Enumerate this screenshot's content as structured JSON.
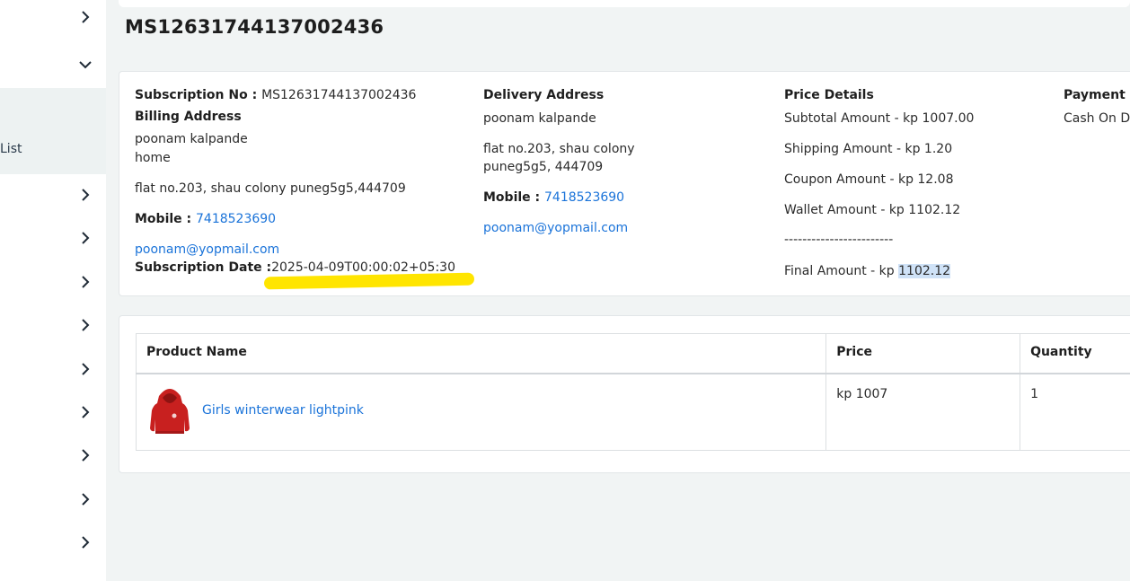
{
  "sidebar": {
    "active_label": "List",
    "chevrons": [
      "right",
      "down",
      "right",
      "right",
      "right",
      "right",
      "right",
      "right",
      "right",
      "right",
      "right"
    ]
  },
  "page": {
    "title": "MS12631744137002436"
  },
  "subscription": {
    "number_label": "Subscription No : ",
    "number": "MS12631744137002436",
    "billing_heading": "Billing Address",
    "billing_name": "poonam kalpande",
    "billing_type": "home",
    "billing_address": "flat no.203, shau colony puneg5g5,444709",
    "mobile_label": "Mobile : ",
    "mobile": "7418523690",
    "email": "poonam@yopmail.com",
    "date_label": "Subscription Date :",
    "date": "2025-04-09T00:00:02+05:30"
  },
  "delivery": {
    "heading": "Delivery Address",
    "name": "poonam kalpande",
    "address_line1": "flat no.203, shau colony",
    "address_line2": "puneg5g5, 444709",
    "mobile_label": "Mobile : ",
    "mobile": "7418523690",
    "email": "poonam@yopmail.com"
  },
  "price": {
    "heading": "Price Details",
    "subtotal": "Subtotal Amount - kp 1007.00",
    "shipping": "Shipping Amount - kp 1.20",
    "coupon": "Coupon Amount - kp 12.08",
    "wallet": "Wallet Amount - kp 1102.12",
    "divider": "------------------------",
    "final_label": "Final Amount - kp ",
    "final_value": "1102.12"
  },
  "payment": {
    "heading": "Payment M",
    "method": "Cash On D"
  },
  "products": {
    "headers": [
      "Product Name",
      "Price",
      "Quantity"
    ],
    "rows": [
      {
        "name": "Girls winterwear lightpink",
        "price": "kp 1007",
        "quantity": "1"
      }
    ]
  },
  "colors": {
    "link": "#1a73d9",
    "highlight": "#ffe500",
    "selection": "#cfe2f7"
  }
}
